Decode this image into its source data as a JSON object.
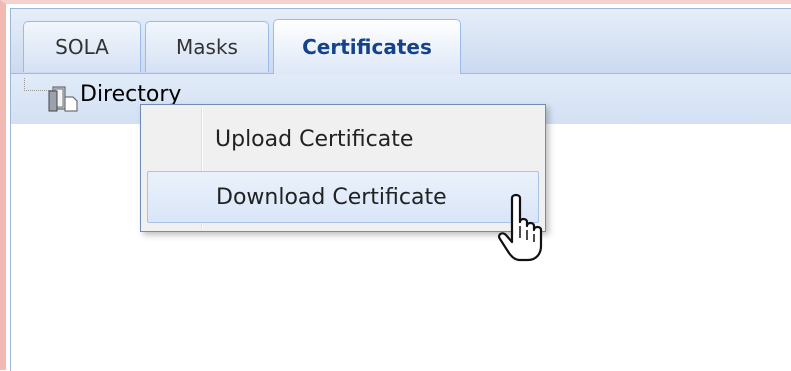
{
  "tabs": [
    {
      "label": "SOLA",
      "active": false
    },
    {
      "label": "Masks",
      "active": false
    },
    {
      "label": "Certificates",
      "active": true
    }
  ],
  "tree": {
    "root_label": "Directory",
    "root_icon": "directory-icon"
  },
  "context_menu": {
    "items": [
      {
        "label": "Upload Certificate",
        "hovered": false
      },
      {
        "label": "Download Certificate",
        "hovered": true
      }
    ]
  },
  "cursor": "hand-pointer-icon",
  "colors": {
    "tab_border": "#99bbe8",
    "active_tab_text": "#15428b",
    "menu_border": "#718bb7",
    "hover_highlight": "#d9e6f8",
    "outer_glow": "#f2b9b3"
  }
}
